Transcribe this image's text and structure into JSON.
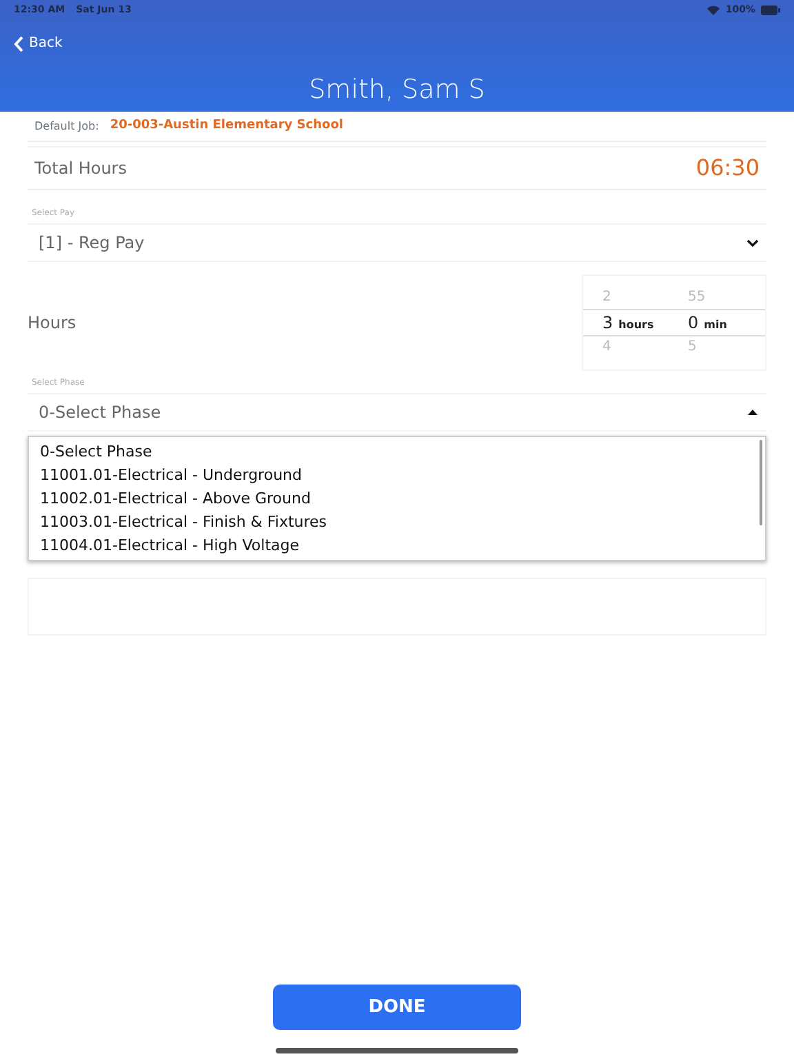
{
  "status_bar": {
    "time": "12:30 AM",
    "date": "Sat Jun 13",
    "battery": "100%"
  },
  "nav": {
    "back": "Back",
    "title": "Smith, Sam S"
  },
  "default_job": {
    "label": "Default Job:",
    "value": "20-003-Austin Elementary School"
  },
  "total_hours": {
    "label": "Total Hours",
    "value": "06:30"
  },
  "pay": {
    "label": "Select Pay",
    "value": "[1] - Reg Pay",
    "expanded": false
  },
  "hours": {
    "label": "Hours",
    "picker": [
      {
        "unit": "hours",
        "values": [
          {
            "text": "2",
            "selected": false
          },
          {
            "text": "3",
            "selected": true
          },
          {
            "text": "4",
            "selected": false
          }
        ]
      },
      {
        "unit": "min",
        "values": [
          {
            "text": "55",
            "selected": false
          },
          {
            "text": "0",
            "selected": true
          },
          {
            "text": "5",
            "selected": false
          }
        ]
      }
    ]
  },
  "phase": {
    "label": "Select Phase",
    "value": "0-Select Phase",
    "expanded": true,
    "options": [
      "0-Select Phase",
      "11001.01-Electrical - Underground",
      "11002.01-Electrical - Above Ground",
      "11003.01-Electrical - Finish & Fixtures",
      "11004.01-Electrical - High Voltage"
    ]
  },
  "done_button": "DONE"
}
